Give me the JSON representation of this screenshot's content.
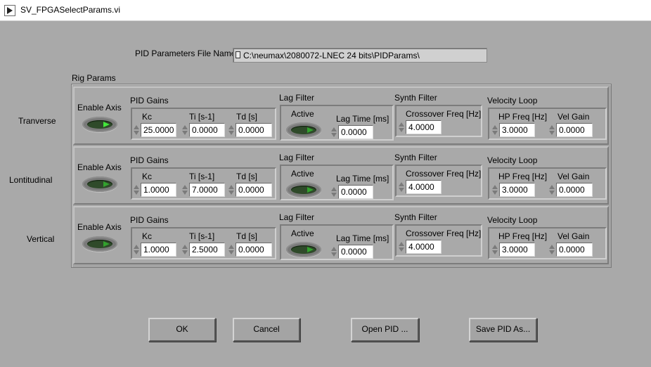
{
  "window": {
    "title": "SV_FPGASelectParams.vi",
    "icon": "labview-vi-icon"
  },
  "file": {
    "label": "PID Parameters File Name",
    "path": "C:\\neumax\\2080072-LNEC 24 bits\\PIDParams\\",
    "icon": "path-icon"
  },
  "rig_params": {
    "label": "Rig Params",
    "axes": [
      {
        "name": "Tranverse",
        "enable_label": "Enable Axis",
        "enable_on": true,
        "pid_label": "PID Gains",
        "kc_label": "Kc",
        "ti_label": "Ti [s-1]",
        "td_label": "Td [s]",
        "kc": "25.0000",
        "ti": "0.0000",
        "td": "0.0000",
        "lag_label": "Lag Filter",
        "active_label": "Active",
        "lag_time_label": "Lag Time [ms]",
        "lag_time": "0.0000",
        "synth_label": "Synth Filter",
        "crossover_label": "Crossover Freq [Hz]",
        "crossover": "4.0000",
        "vel_label": "Velocity Loop",
        "hp_label": "HP Freq [Hz]",
        "vel_gain_label": "Vel Gain",
        "hp": "3.0000",
        "vel_gain": "0.0000"
      },
      {
        "name": "Lontitudinal",
        "enable_label": "Enable Axis",
        "enable_on": false,
        "pid_label": "PID Gains",
        "kc_label": "Kc",
        "ti_label": "Ti [s-1]",
        "td_label": "Td [s]",
        "kc": "1.0000",
        "ti": "7.0000",
        "td": "0.0000",
        "lag_label": "Lag Filter",
        "active_label": "Active",
        "lag_time_label": "Lag Time [ms]",
        "lag_time": "0.0000",
        "synth_label": "Synth Filter",
        "crossover_label": "Crossover Freq [Hz]",
        "crossover": "4.0000",
        "vel_label": "Velocity Loop",
        "hp_label": "HP Freq [Hz]",
        "vel_gain_label": "Vel Gain",
        "hp": "3.0000",
        "vel_gain": "0.0000"
      },
      {
        "name": "Vertical",
        "enable_label": "Enable Axis",
        "enable_on": false,
        "pid_label": "PID Gains",
        "kc_label": "Kc",
        "ti_label": "Ti [s-1]",
        "td_label": "Td [s]",
        "kc": "1.0000",
        "ti": "2.5000",
        "td": "0.0000",
        "lag_label": "Lag Filter",
        "active_label": "Active",
        "lag_time_label": "Lag Time [ms]",
        "lag_time": "0.0000",
        "synth_label": "Synth Filter",
        "crossover_label": "Crossover Freq [Hz]",
        "crossover": "4.0000",
        "vel_label": "Velocity Loop",
        "hp_label": "HP Freq [Hz]",
        "vel_gain_label": "Vel Gain",
        "hp": "3.0000",
        "vel_gain": "0.0000"
      }
    ]
  },
  "buttons": {
    "ok": "OK",
    "cancel": "Cancel",
    "open_pid": "Open PID ...",
    "save_pid": "Save PID As..."
  }
}
